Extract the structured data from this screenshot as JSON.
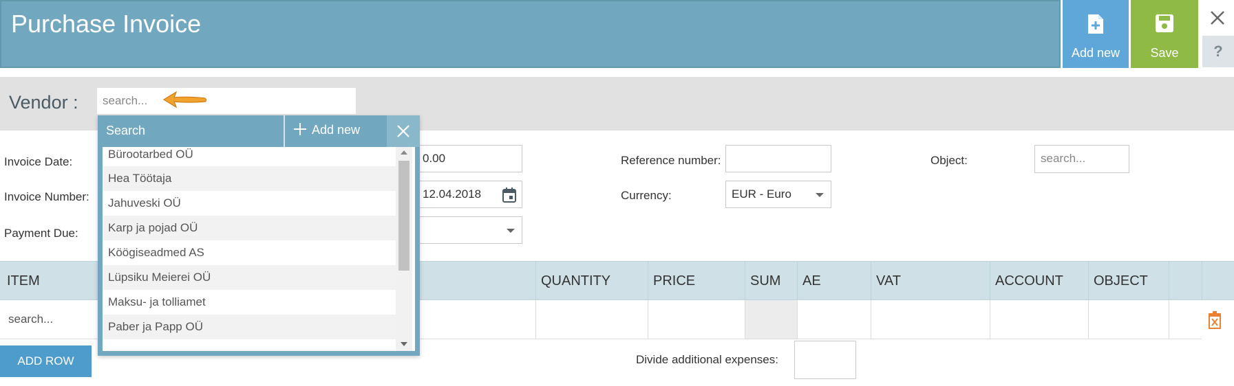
{
  "header": {
    "title": "Purchase Invoice",
    "add_new_label": "Add new",
    "save_label": "Save",
    "help_label": "?",
    "colors": {
      "bar": "#71a8bf",
      "add_new": "#5fa7d8",
      "save": "#8fba45"
    }
  },
  "vendor": {
    "label": "Vendor :",
    "placeholder": "search..."
  },
  "dropdown": {
    "search_label": "Search",
    "add_new_label": "Add new",
    "items": [
      "Bürootarbed OÜ",
      "Hea Töötaja",
      "Jahuveski OÜ",
      "Karp ja pojad OÜ",
      "Köögiseadmed AS",
      "Lüpsiku Meierei OÜ",
      "Maksu- ja tolliamet",
      "Paber ja Papp OÜ"
    ]
  },
  "form": {
    "invoice_date_label": "Invoice Date:",
    "invoice_number_label": "Invoice Number:",
    "payment_due_label": "Payment Due:",
    "amount_value": "0.00",
    "date_value": "12.04.2018",
    "reference_label": "Reference number:",
    "currency_label": "Currency:",
    "currency_value": "EUR - Euro",
    "object_label": "Object:",
    "object_placeholder": "search..."
  },
  "table": {
    "headers": [
      "ITEM",
      "QUANTITY",
      "PRICE",
      "SUM",
      "AE",
      "VAT",
      "ACCOUNT",
      "OBJECT"
    ],
    "row_placeholder": "search..."
  },
  "add_row_label": "ADD ROW",
  "divide_label": "Divide additional expenses:"
}
